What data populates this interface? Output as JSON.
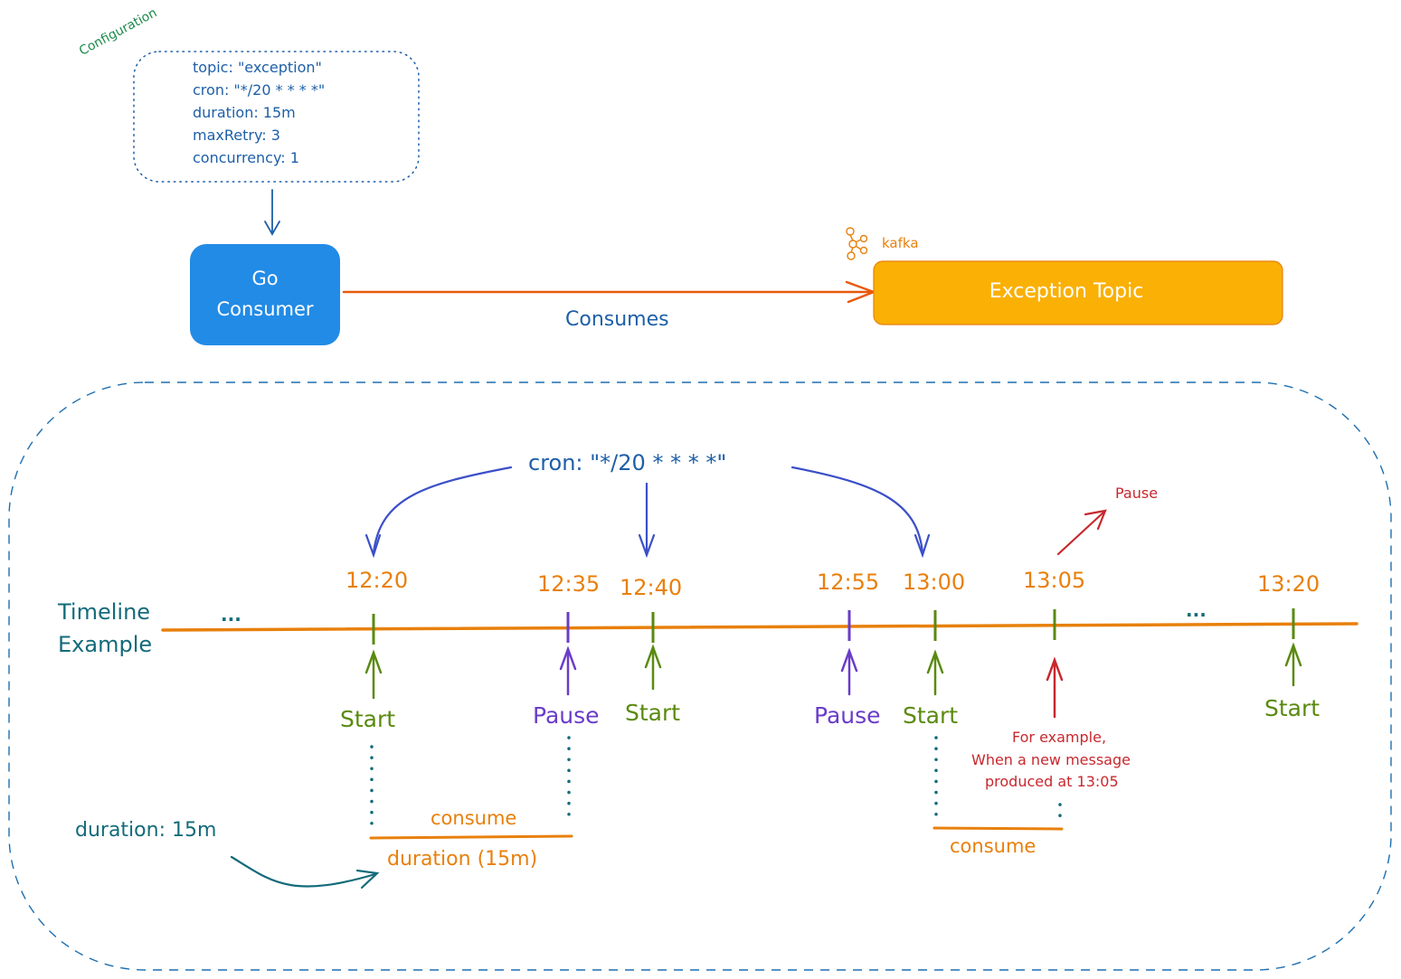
{
  "config": {
    "label": "Configuration",
    "lines": [
      "topic: \"exception\"",
      "cron: \"*/20 * * * *\"",
      "duration: 15m",
      "maxRetry: 3",
      "concurrency: 1"
    ]
  },
  "consumer": {
    "line1": "Go",
    "line2": "Consumer",
    "color": "#228be6"
  },
  "edge": {
    "label": "Consumes",
    "color": "#e8590c"
  },
  "topic": {
    "label": "Exception Topic",
    "logo_text": "kafka",
    "color": "#fab005"
  },
  "timeline": {
    "title_line1": "Timeline",
    "title_line2": "Example",
    "ellipsis_left": "...",
    "ellipsis_right": "...",
    "cron_label": "cron: \"*/20 * * * *\"",
    "ticks": [
      {
        "time": "12:20",
        "event": "Start",
        "kind": "start"
      },
      {
        "time": "12:35",
        "event": "Pause",
        "kind": "pause"
      },
      {
        "time": "12:40",
        "event": "Start",
        "kind": "start"
      },
      {
        "time": "12:55",
        "event": "Pause",
        "kind": "pause"
      },
      {
        "time": "13:00",
        "event": "Start",
        "kind": "start"
      },
      {
        "time": "13:05",
        "event": "",
        "kind": "message"
      },
      {
        "time": "13:20",
        "event": "Start",
        "kind": "start"
      }
    ],
    "consume_label_1": "consume",
    "duration_label": "duration (15m)",
    "duration_note": "duration: 15m",
    "consume_label_2": "consume",
    "message_note": [
      "For example,",
      "When a new message",
      "produced at 13:05"
    ],
    "message_pause": "Pause"
  },
  "colors": {
    "start": "#5a8a10",
    "pause": "#6a3cc8",
    "timeline": "#e8800c",
    "cron_arrow": "#3b4fc8",
    "note_red": "#c8282e",
    "teal": "#136b7a",
    "frame": "#1e6fb0"
  }
}
